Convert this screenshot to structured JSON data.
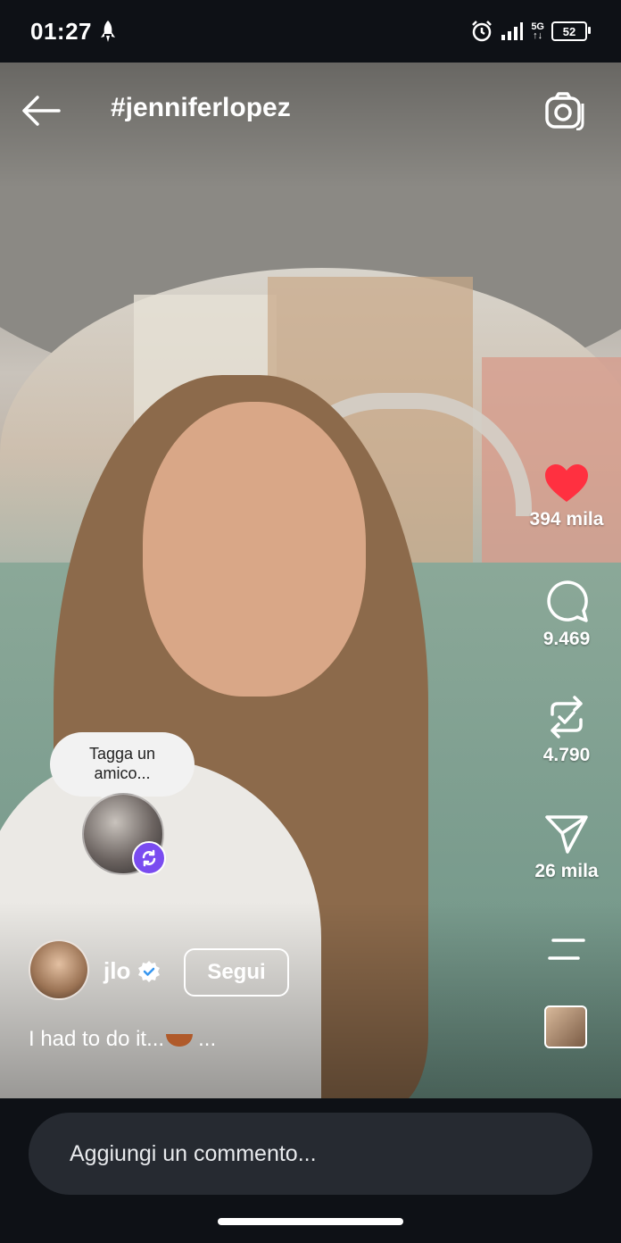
{
  "status_bar": {
    "time": "01:27",
    "network_label_top": "5G",
    "network_label_bottom": "↑↓",
    "battery": "52"
  },
  "header": {
    "title": "#jenniferlopez"
  },
  "actions": {
    "likes": "394 mila",
    "comments": "9.469",
    "reposts": "4.790",
    "shares": "26 mila"
  },
  "tag_prompt": {
    "text_line1": "Tagga un",
    "text_line2": "amico..."
  },
  "author": {
    "username": "jlo",
    "follow_label": "Segui"
  },
  "caption": {
    "text": "I had to do it...",
    "more": "..."
  },
  "comment_bar": {
    "placeholder": "Aggiungi un commento..."
  },
  "colors": {
    "like_red": "#ff3040",
    "badge_purple": "#7a4cf0",
    "background": "#0e1116",
    "input_bg": "#262a31"
  }
}
